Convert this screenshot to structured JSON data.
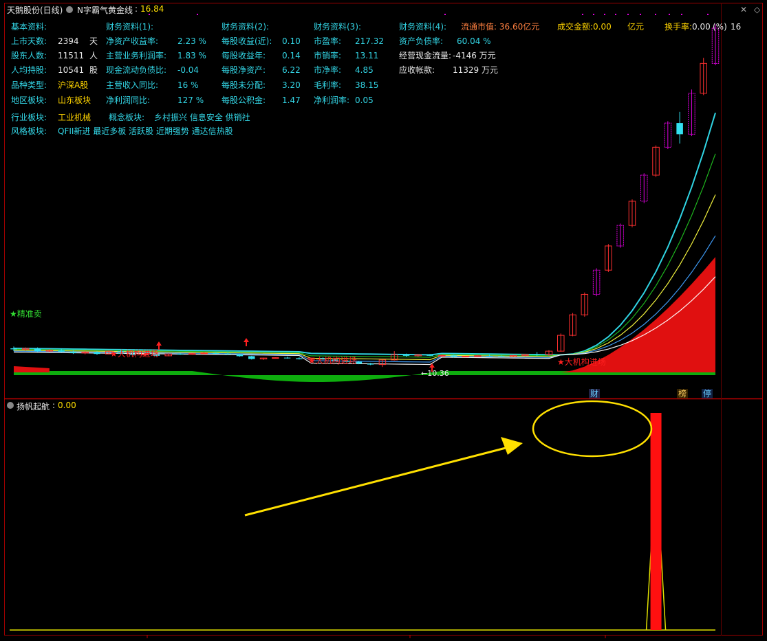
{
  "header": {
    "title": "天鹅股份(日线)",
    "indicator": "N字霸气黄金线",
    "indicator_value": "16.84",
    "turnover_label": "换手率:",
    "turnover_value": "0.00",
    "turnover_tail": "(%)",
    "float_cap": "流通市值: 36.60亿元",
    "volume_amount": "成交金额:0.00",
    "volume_unit": "亿元",
    "right_tail": "16"
  },
  "info": {
    "basic_title": "基本资料:",
    "fin1_title": "财务资料(1):",
    "fin2_title": "财务资料(2):",
    "fin3_title": "财务资料(3):",
    "fin4_title": "财务资料(4):",
    "basic": [
      {
        "label": "上市天数:",
        "value": "2394",
        "unit": "天"
      },
      {
        "label": "股东人数:",
        "value": "11511",
        "unit": "人"
      },
      {
        "label": "人均持股:",
        "value": "10541",
        "unit": "股"
      },
      {
        "label": "品种类型:",
        "value": "沪深A股",
        "unit": ""
      },
      {
        "label": "地区板块:",
        "value": "山东板块",
        "unit": ""
      }
    ],
    "fin1": [
      {
        "label": "净资产收益率:",
        "value": "2.23 %"
      },
      {
        "label": "主营业务利润率:",
        "value": "1.83 %"
      },
      {
        "label": "现金流动负债比:",
        "value": "-0.04"
      },
      {
        "label": "主营收入同比:",
        "value": "16 %"
      },
      {
        "label": "净利润同比:",
        "value": "127 %"
      }
    ],
    "fin2": [
      {
        "label": "每股收益(近):",
        "value": "0.10"
      },
      {
        "label": "每股收益年:",
        "value": "0.14"
      },
      {
        "label": "每股净资产:",
        "value": "6.22"
      },
      {
        "label": "每股未分配:",
        "value": "3.20"
      },
      {
        "label": "每股公积金:",
        "value": "1.47"
      }
    ],
    "fin3": [
      {
        "label": "市盈率:",
        "value": "217.32"
      },
      {
        "label": "市销率:",
        "value": "13.11"
      },
      {
        "label": "市净率:",
        "value": "4.85"
      },
      {
        "label": "毛利率:",
        "value": "38.15"
      },
      {
        "label": "净利润率:",
        "value": "0.05"
      }
    ],
    "fin4": [
      {
        "label": "资产负债率:",
        "value": "60.04 %"
      },
      {
        "label": "经营现金流量:",
        "value": "-4146 万元"
      },
      {
        "label": "应收帐款:",
        "value": "11329 万元"
      }
    ],
    "industry_label": "行业板块:",
    "industry_value": "工业机械",
    "concept_label": "概念板块:",
    "concept_value": "乡村振兴 信息安全 供销社",
    "style_label": "风格板块:",
    "style_value": "QFII新进 最近多板 活跃股 近期强势 通达信热股"
  },
  "annotations": {
    "sell_signal": "★精准卖",
    "inst_entry": "★大机构进场",
    "low_price": "←10.36",
    "caibao_badge": "财",
    "bang_badge": "榜",
    "ting_badge": "停"
  },
  "sub_panel": {
    "title": "扬帆起航",
    "value": "0.00"
  },
  "colors": {
    "background": "#000000",
    "frame": "#b00000",
    "up": "#ff3030",
    "down": "#33e0f0",
    "signal": "#ff1010",
    "highlight": "#ffff00",
    "ma_zone": "#e0e000"
  },
  "chart_data": {
    "type": "candlestick",
    "low_label_value": 10.36,
    "candles": [
      [
        10.9,
        11.0,
        10.75,
        10.85
      ],
      [
        10.85,
        10.95,
        10.78,
        10.9
      ],
      [
        10.9,
        10.95,
        10.7,
        10.75
      ],
      [
        10.75,
        10.85,
        10.7,
        10.8
      ],
      [
        10.8,
        10.9,
        10.68,
        10.72
      ],
      [
        10.72,
        10.8,
        10.6,
        10.65
      ],
      [
        10.65,
        10.75,
        10.58,
        10.7
      ],
      [
        10.7,
        10.75,
        10.55,
        10.6
      ],
      [
        10.6,
        10.8,
        10.58,
        10.75
      ],
      [
        10.75,
        10.8,
        10.6,
        10.62
      ],
      [
        10.62,
        10.7,
        10.52,
        10.55
      ],
      [
        10.55,
        10.62,
        10.5,
        10.58
      ],
      [
        10.58,
        10.62,
        10.48,
        10.5
      ],
      [
        10.5,
        10.62,
        10.48,
        10.6
      ],
      [
        10.6,
        10.65,
        10.55,
        10.58
      ],
      [
        10.58,
        10.65,
        10.55,
        10.62
      ],
      [
        10.62,
        10.7,
        10.6,
        10.65
      ],
      [
        10.65,
        10.7,
        10.6,
        10.62
      ],
      [
        10.62,
        10.68,
        10.55,
        10.58
      ],
      [
        10.58,
        10.6,
        10.45,
        10.48
      ],
      [
        10.48,
        10.5,
        10.3,
        10.33
      ],
      [
        10.33,
        10.4,
        10.28,
        10.38
      ],
      [
        10.38,
        10.42,
        10.36,
        10.4
      ],
      [
        10.4,
        10.45,
        10.35,
        10.37
      ],
      [
        10.37,
        10.42,
        10.3,
        10.32
      ],
      [
        10.32,
        10.4,
        10.25,
        10.38
      ],
      [
        10.38,
        10.42,
        10.28,
        10.3
      ],
      [
        10.3,
        10.35,
        10.2,
        10.24
      ],
      [
        10.24,
        10.28,
        10.15,
        10.18
      ],
      [
        10.18,
        10.22,
        10.05,
        10.08
      ],
      [
        10.08,
        10.12,
        10.0,
        10.03
      ],
      [
        10.03,
        10.3,
        9.9,
        10.28
      ],
      [
        10.28,
        10.75,
        10.25,
        10.55
      ],
      [
        10.55,
        10.62,
        10.45,
        10.5
      ],
      [
        10.5,
        10.6,
        10.45,
        10.55
      ],
      [
        10.55,
        10.6,
        10.48,
        10.5
      ],
      [
        10.5,
        10.58,
        10.45,
        10.52
      ],
      [
        10.52,
        10.55,
        10.4,
        10.45
      ],
      [
        10.45,
        10.5,
        10.42,
        10.48
      ],
      [
        10.48,
        10.55,
        10.44,
        10.5
      ],
      [
        10.5,
        10.55,
        10.45,
        10.48
      ],
      [
        10.48,
        10.52,
        10.42,
        10.45
      ],
      [
        10.45,
        10.55,
        10.43,
        10.52
      ],
      [
        10.52,
        10.6,
        10.48,
        10.58
      ],
      [
        10.58,
        10.7,
        10.5,
        10.55
      ],
      [
        10.55,
        10.8,
        10.5,
        10.75
      ],
      [
        10.75,
        11.7,
        10.72,
        11.6
      ],
      [
        11.6,
        12.8,
        11.55,
        12.7
      ],
      [
        12.7,
        13.9,
        12.6,
        13.8
      ],
      [
        13.8,
        15.2,
        13.7,
        15.1
      ],
      [
        15.1,
        16.5,
        15.0,
        16.4
      ],
      [
        16.4,
        17.6,
        16.3,
        17.5
      ],
      [
        17.5,
        18.9,
        17.4,
        18.8
      ],
      [
        18.8,
        20.3,
        18.7,
        20.2
      ],
      [
        20.2,
        21.8,
        20.1,
        21.7
      ],
      [
        21.7,
        23.1,
        21.6,
        23.0
      ],
      [
        23.0,
        23.6,
        21.9,
        22.4
      ],
      [
        22.4,
        24.8,
        22.3,
        24.6
      ],
      [
        24.6,
        26.5,
        24.5,
        26.2
      ],
      [
        26.2,
        28.3,
        26.1,
        28.1
      ]
    ],
    "sub_series": [
      0,
      0,
      0,
      0,
      0,
      0,
      0,
      0,
      0,
      0,
      0,
      0,
      0,
      0,
      0,
      0,
      0,
      0,
      0,
      0,
      0,
      0,
      0,
      0,
      0,
      0,
      0,
      0,
      0,
      0,
      0,
      0,
      0,
      0,
      0,
      0,
      0,
      0,
      0,
      0,
      0,
      0,
      0,
      0,
      0,
      0,
      0,
      0,
      0,
      0,
      0,
      0,
      0,
      0,
      1,
      0,
      0,
      0,
      0,
      0
    ],
    "signal_index": 54
  }
}
